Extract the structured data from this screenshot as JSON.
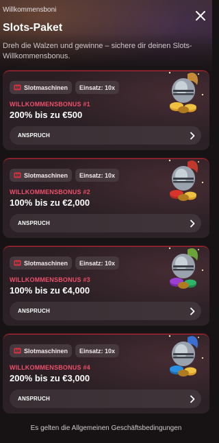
{
  "header": {
    "eyebrow": "Willkommensboni",
    "title": "Slots-Paket",
    "subtitle": "Dreh die Walzen und gewinne – sichere dir deinen Slots-Willkommensbonus."
  },
  "cards": [
    {
      "tag_category": "Slotmaschinen",
      "tag_wager": "Einsatz: 10x",
      "bonus_label": "WILLKOMMENSBONUS #1",
      "offer": "200% bis zu €500",
      "button_label": "ANSPRUCH",
      "plume_color": "#c48a3a",
      "gem_colors": [
        "#d89a2a",
        "#f0c040"
      ]
    },
    {
      "tag_category": "Slotmaschinen",
      "tag_wager": "Einsatz: 10x",
      "bonus_label": "WILLKOMMENSBONUS #2",
      "offer": "100% bis zu €2,000",
      "button_label": "ANSPRUCH",
      "plume_color": "#c0392b",
      "gem_colors": [
        "#d8342c",
        "#f0c040"
      ]
    },
    {
      "tag_category": "Slotmaschinen",
      "tag_wager": "Einsatz: 10x",
      "bonus_label": "WILLKOMMENSBONUS #3",
      "offer": "100% bis zu €4,000",
      "button_label": "ANSPRUCH",
      "plume_color": "#6aa33a",
      "gem_colors": [
        "#9b3fd1",
        "#2fb56a"
      ]
    },
    {
      "tag_category": "Slotmaschinen",
      "tag_wager": "Einsatz: 10x",
      "bonus_label": "WILLKOMMENSBONUS #4",
      "offer": "200% bis zu €3,000",
      "button_label": "ANSPRUCH",
      "plume_color": "#3a6fd1",
      "gem_colors": [
        "#2a8fe0",
        "#f0c040"
      ]
    }
  ],
  "footer": {
    "note": "Es gelten die Allgemeinen Geschäftsbedingungen"
  },
  "icons": {
    "close": "close-icon",
    "slot": "slot-machine-icon",
    "chevron": "chevron-right-icon",
    "knight": "knight-helmet-icon"
  },
  "colors": {
    "accent_red": "#f0506b",
    "card_border": "#a92733",
    "background": "#171214"
  }
}
